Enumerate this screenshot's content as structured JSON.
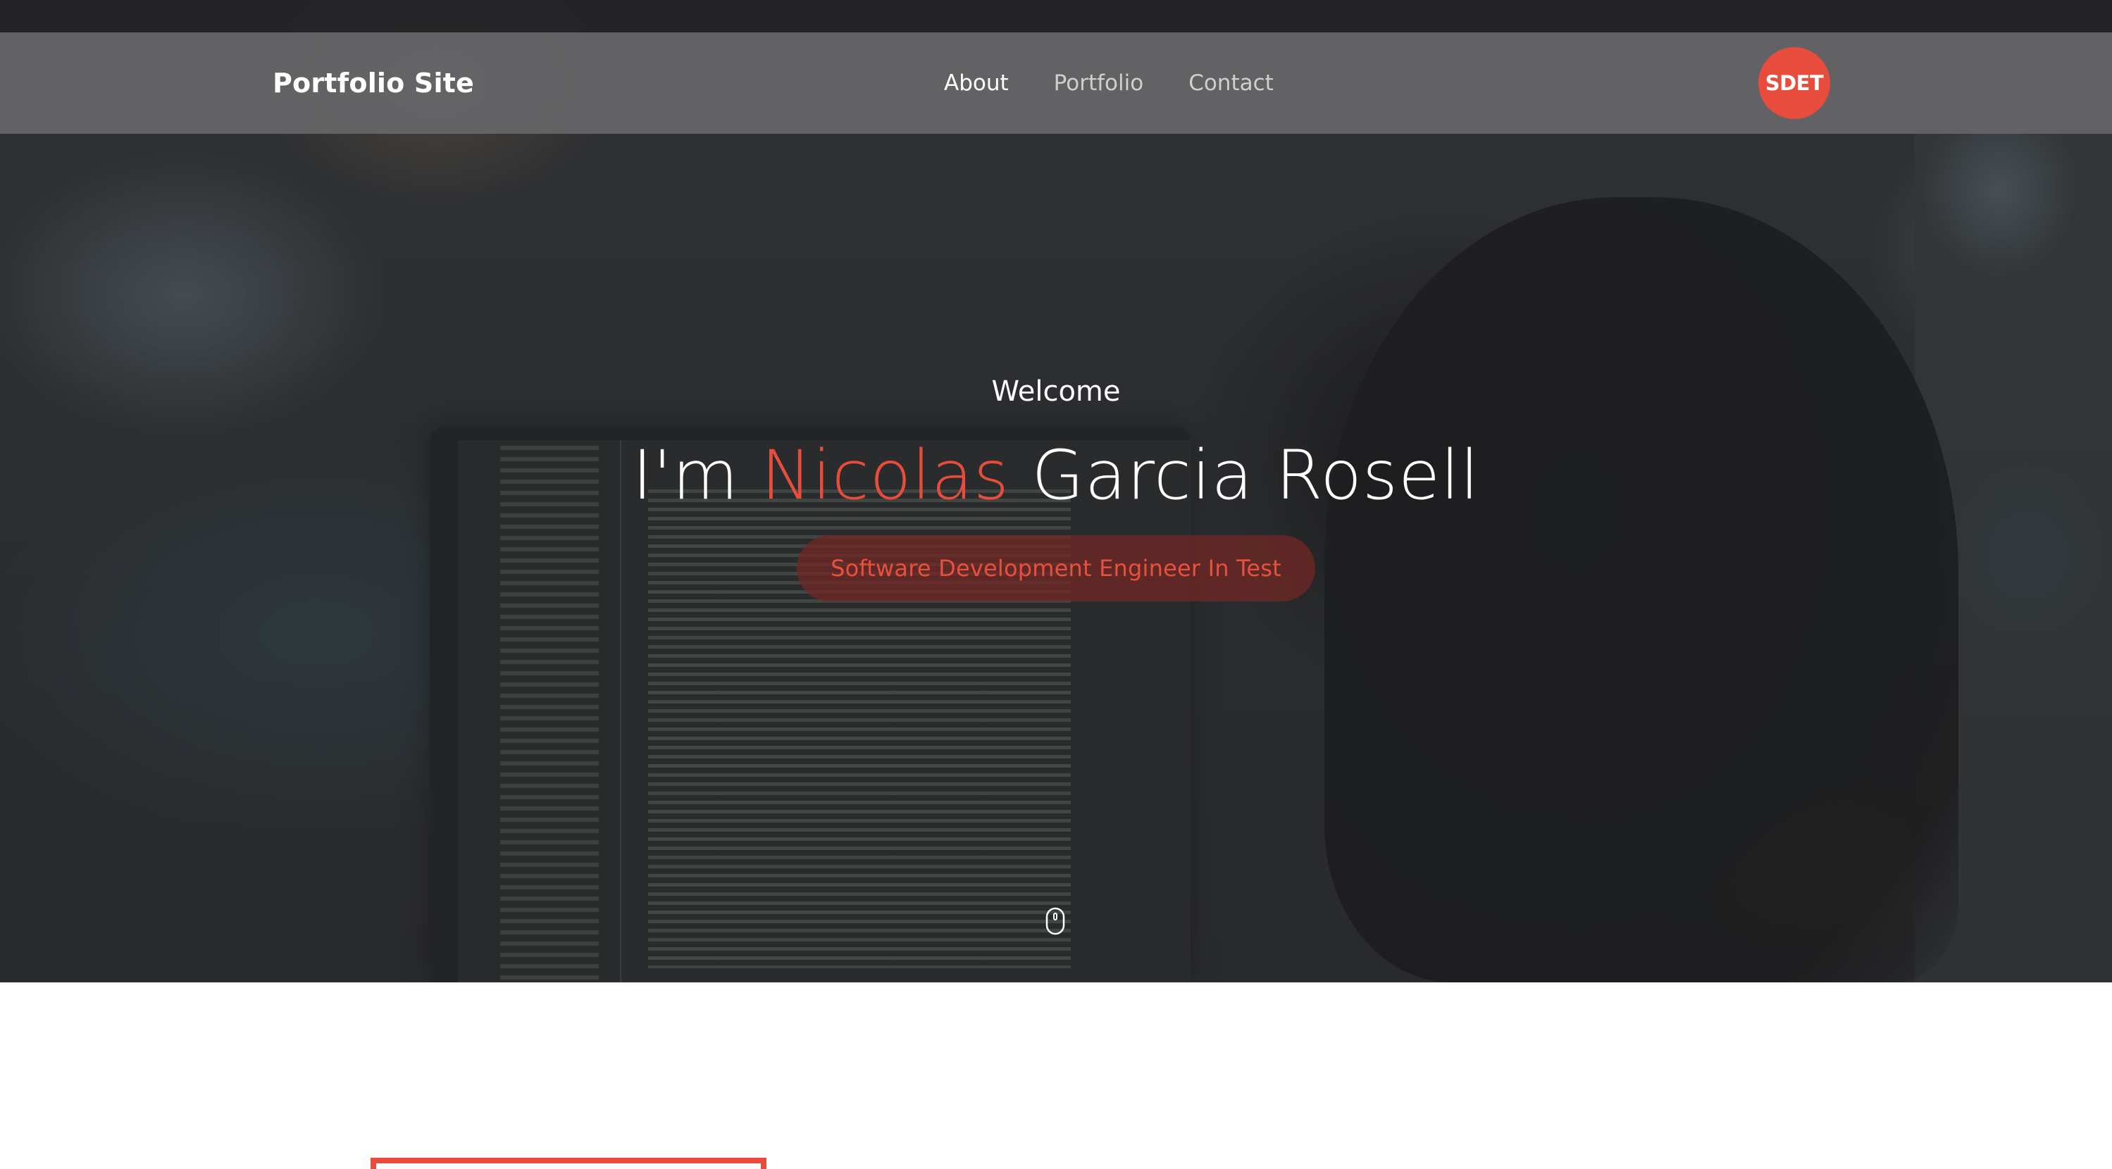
{
  "navbar": {
    "brand": "Portfolio Site",
    "links": [
      {
        "label": "About",
        "active": true
      },
      {
        "label": "Portfolio",
        "active": false
      },
      {
        "label": "Contact",
        "active": false
      }
    ],
    "badge": "SDET"
  },
  "hero": {
    "welcome": "Welcome",
    "title_prefix": "I'm ",
    "title_highlight": "Nicolas",
    "title_suffix": " Garcia Rosell",
    "role": "Software Development Engineer In Test",
    "scroll_icon": "mouse-scroll-icon"
  },
  "colors": {
    "accent": "#e74c3c",
    "navbar_bg": "#666668",
    "text": "#ffffff"
  }
}
